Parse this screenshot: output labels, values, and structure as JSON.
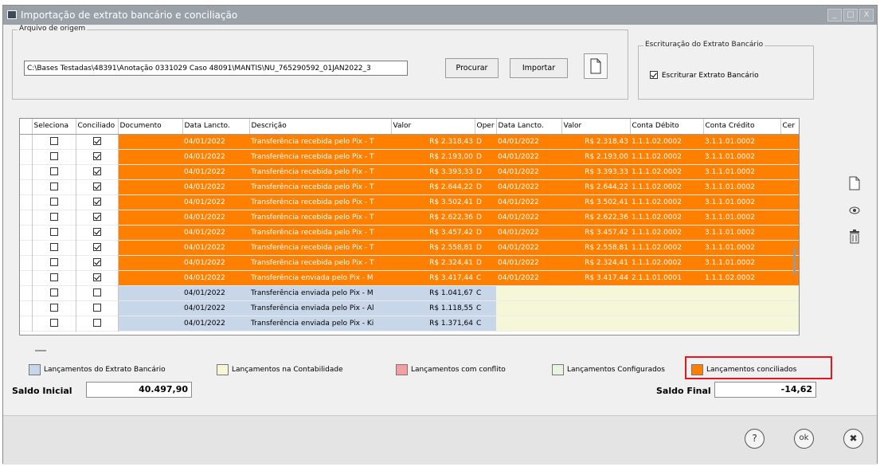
{
  "window": {
    "title": "Importação de extrato bancário e conciliação",
    "buttons": {
      "minimize": "_",
      "maximize": "□",
      "close": "X"
    }
  },
  "origin": {
    "legend": "Arquivo de origem",
    "path": "C:\\Bases Testadas\\48391\\Anotação 0331029 Caso 48091\\MANTIS\\NU_765290592_01JAN2022_3",
    "search_label": "Procurar",
    "import_label": "Importar"
  },
  "escrituracao": {
    "legend": "Escrituração do Extrato Bancário",
    "checkbox_label": "Escriturar Extrato Bancário",
    "checked": true
  },
  "grid": {
    "columns": [
      "Seleciona",
      "Conciliado",
      "Documento",
      "Data Lancto.",
      "Descrição",
      "Valor",
      "Oper",
      "Data Lancto.",
      "Valor",
      "Conta Débito",
      "Conta Crédito",
      "Cer"
    ],
    "rows": [
      {
        "status": "conciliado",
        "conciliado": true,
        "documento": "",
        "data": "04/01/2022",
        "descricao": "Transferência recebida pelo Pix - T",
        "valor": "R$ 2.318,43",
        "oper": "D",
        "data2": "04/01/2022",
        "valor2": "R$ 2.318,43",
        "debito": "1.1.1.02.0002",
        "credito": "3.1.1.01.0002"
      },
      {
        "status": "conciliado",
        "conciliado": true,
        "documento": "",
        "data": "04/01/2022",
        "descricao": "Transferência recebida pelo Pix - T",
        "valor": "R$ 2.193,00",
        "oper": "D",
        "data2": "04/01/2022",
        "valor2": "R$ 2.193,00",
        "debito": "1.1.1.02.0002",
        "credito": "3.1.1.01.0002"
      },
      {
        "status": "conciliado",
        "conciliado": true,
        "documento": "",
        "data": "04/01/2022",
        "descricao": "Transferência recebida pelo Pix - T",
        "valor": "R$ 3.393,33",
        "oper": "D",
        "data2": "04/01/2022",
        "valor2": "R$ 3.393,33",
        "debito": "1.1.1.02.0002",
        "credito": "3.1.1.01.0002"
      },
      {
        "status": "conciliado",
        "conciliado": true,
        "documento": "",
        "data": "04/01/2022",
        "descricao": "Transferência recebida pelo Pix - T",
        "valor": "R$ 2.644,22",
        "oper": "D",
        "data2": "04/01/2022",
        "valor2": "R$ 2.644,22",
        "debito": "1.1.1.02.0002",
        "credito": "3.1.1.01.0002"
      },
      {
        "status": "conciliado",
        "conciliado": true,
        "documento": "",
        "data": "04/01/2022",
        "descricao": "Transferência recebida pelo Pix - T",
        "valor": "R$ 3.502,41",
        "oper": "D",
        "data2": "04/01/2022",
        "valor2": "R$ 3.502,41",
        "debito": "1.1.1.02.0002",
        "credito": "3.1.1.01.0002"
      },
      {
        "status": "conciliado",
        "conciliado": true,
        "documento": "",
        "data": "04/01/2022",
        "descricao": "Transferência recebida pelo Pix - T",
        "valor": "R$ 2.622,36",
        "oper": "D",
        "data2": "04/01/2022",
        "valor2": "R$ 2.622,36",
        "debito": "1.1.1.02.0002",
        "credito": "3.1.1.01.0002"
      },
      {
        "status": "conciliado",
        "conciliado": true,
        "documento": "",
        "data": "04/01/2022",
        "descricao": "Transferência recebida pelo Pix - T",
        "valor": "R$ 3.457,42",
        "oper": "D",
        "data2": "04/01/2022",
        "valor2": "R$ 3.457,42",
        "debito": "1.1.1.02.0002",
        "credito": "3.1.1.01.0002"
      },
      {
        "status": "conciliado",
        "conciliado": true,
        "documento": "",
        "data": "04/01/2022",
        "descricao": "Transferência recebida pelo Pix - T",
        "valor": "R$ 2.558,81",
        "oper": "D",
        "data2": "04/01/2022",
        "valor2": "R$ 2.558,81",
        "debito": "1.1.1.02.0002",
        "credito": "3.1.1.01.0002"
      },
      {
        "status": "conciliado",
        "conciliado": true,
        "documento": "",
        "data": "04/01/2022",
        "descricao": "Transferência recebida pelo Pix - T",
        "valor": "R$ 2.324,41",
        "oper": "D",
        "data2": "04/01/2022",
        "valor2": "R$ 2.324,41",
        "debito": "1.1.1.02.0002",
        "credito": "3.1.1.01.0002"
      },
      {
        "status": "conciliado",
        "conciliado": true,
        "documento": "",
        "data": "04/01/2022",
        "descricao": "Transferência enviada pelo Pix - M",
        "valor": "R$ 3.417,44",
        "oper": "C",
        "data2": "04/01/2022",
        "valor2": "R$ 3.417,44",
        "debito": "2.1.1.01.0001",
        "credito": "1.1.1.02.0002"
      },
      {
        "status": "extrato",
        "conciliado": false,
        "documento": "",
        "data": "04/01/2022",
        "descricao": "Transferência enviada pelo Pix - M",
        "valor": "R$ 1.041,67",
        "oper": "C",
        "data2": "",
        "valor2": "",
        "debito": "",
        "credito": ""
      },
      {
        "status": "extrato",
        "conciliado": false,
        "documento": "",
        "data": "04/01/2022",
        "descricao": "Transferência enviada pelo Pix - Al",
        "valor": "R$ 1.118,55",
        "oper": "C",
        "data2": "",
        "valor2": "",
        "debito": "",
        "credito": ""
      },
      {
        "status": "extrato",
        "conciliado": false,
        "documento": "",
        "data": "04/01/2022",
        "descricao": "Transferência enviada pelo Pix - Ki",
        "valor": "R$ 1.371,64",
        "oper": "C",
        "data2": "",
        "valor2": "",
        "debito": "",
        "credito": ""
      }
    ]
  },
  "legend": [
    {
      "label": "Lançamentos do Extrato Bancário",
      "color": "#c7d6e8"
    },
    {
      "label": "Lançamentos na Contabilidade",
      "color": "#f6f7d8"
    },
    {
      "label": "Lançamentos com conflito",
      "color": "#f4a0a0"
    },
    {
      "label": "Lançamentos Configurados",
      "color": "#e7f4e0"
    },
    {
      "label": "Lançamentos conciliados",
      "color": "#ff8000"
    }
  ],
  "saldo": {
    "inicial_label": "Saldo Inicial",
    "inicial_value": "40.497,90",
    "final_label": "Saldo Final",
    "final_value": "-14,62"
  },
  "footer": {
    "help_label": "?",
    "ok_label": "ok",
    "cancel_label": "✖"
  },
  "colors": {
    "conciliado": "#ff8000",
    "extrato": "#c7d6e8",
    "contabilidade": "#f6f7d8",
    "highlight": "#e8141e"
  }
}
